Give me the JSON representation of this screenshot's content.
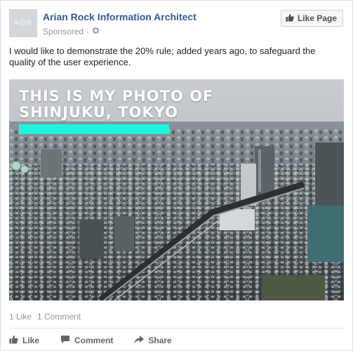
{
  "post": {
    "avatar_text": "AGR",
    "page_name": "Arian Rock Information Architect",
    "sponsored": "Sponsored",
    "dot": "·",
    "like_page": "Like Page",
    "text": "I would like to demonstrate the 20% rule; added years ago, to safeguard the quality of the user experience."
  },
  "photo": {
    "title_line1": "THIS IS MY PHOTO OF",
    "title_line2": "SHINJUKU, TOKYO",
    "bar_color": "#1ef5e0"
  },
  "stats": {
    "likes": "1 Like",
    "comments": "1 Comment"
  },
  "actions": {
    "like": "Like",
    "comment": "Comment",
    "share": "Share"
  },
  "colors": {
    "link": "#365899",
    "meta": "#90949c",
    "accent": "#1ef5e0"
  }
}
